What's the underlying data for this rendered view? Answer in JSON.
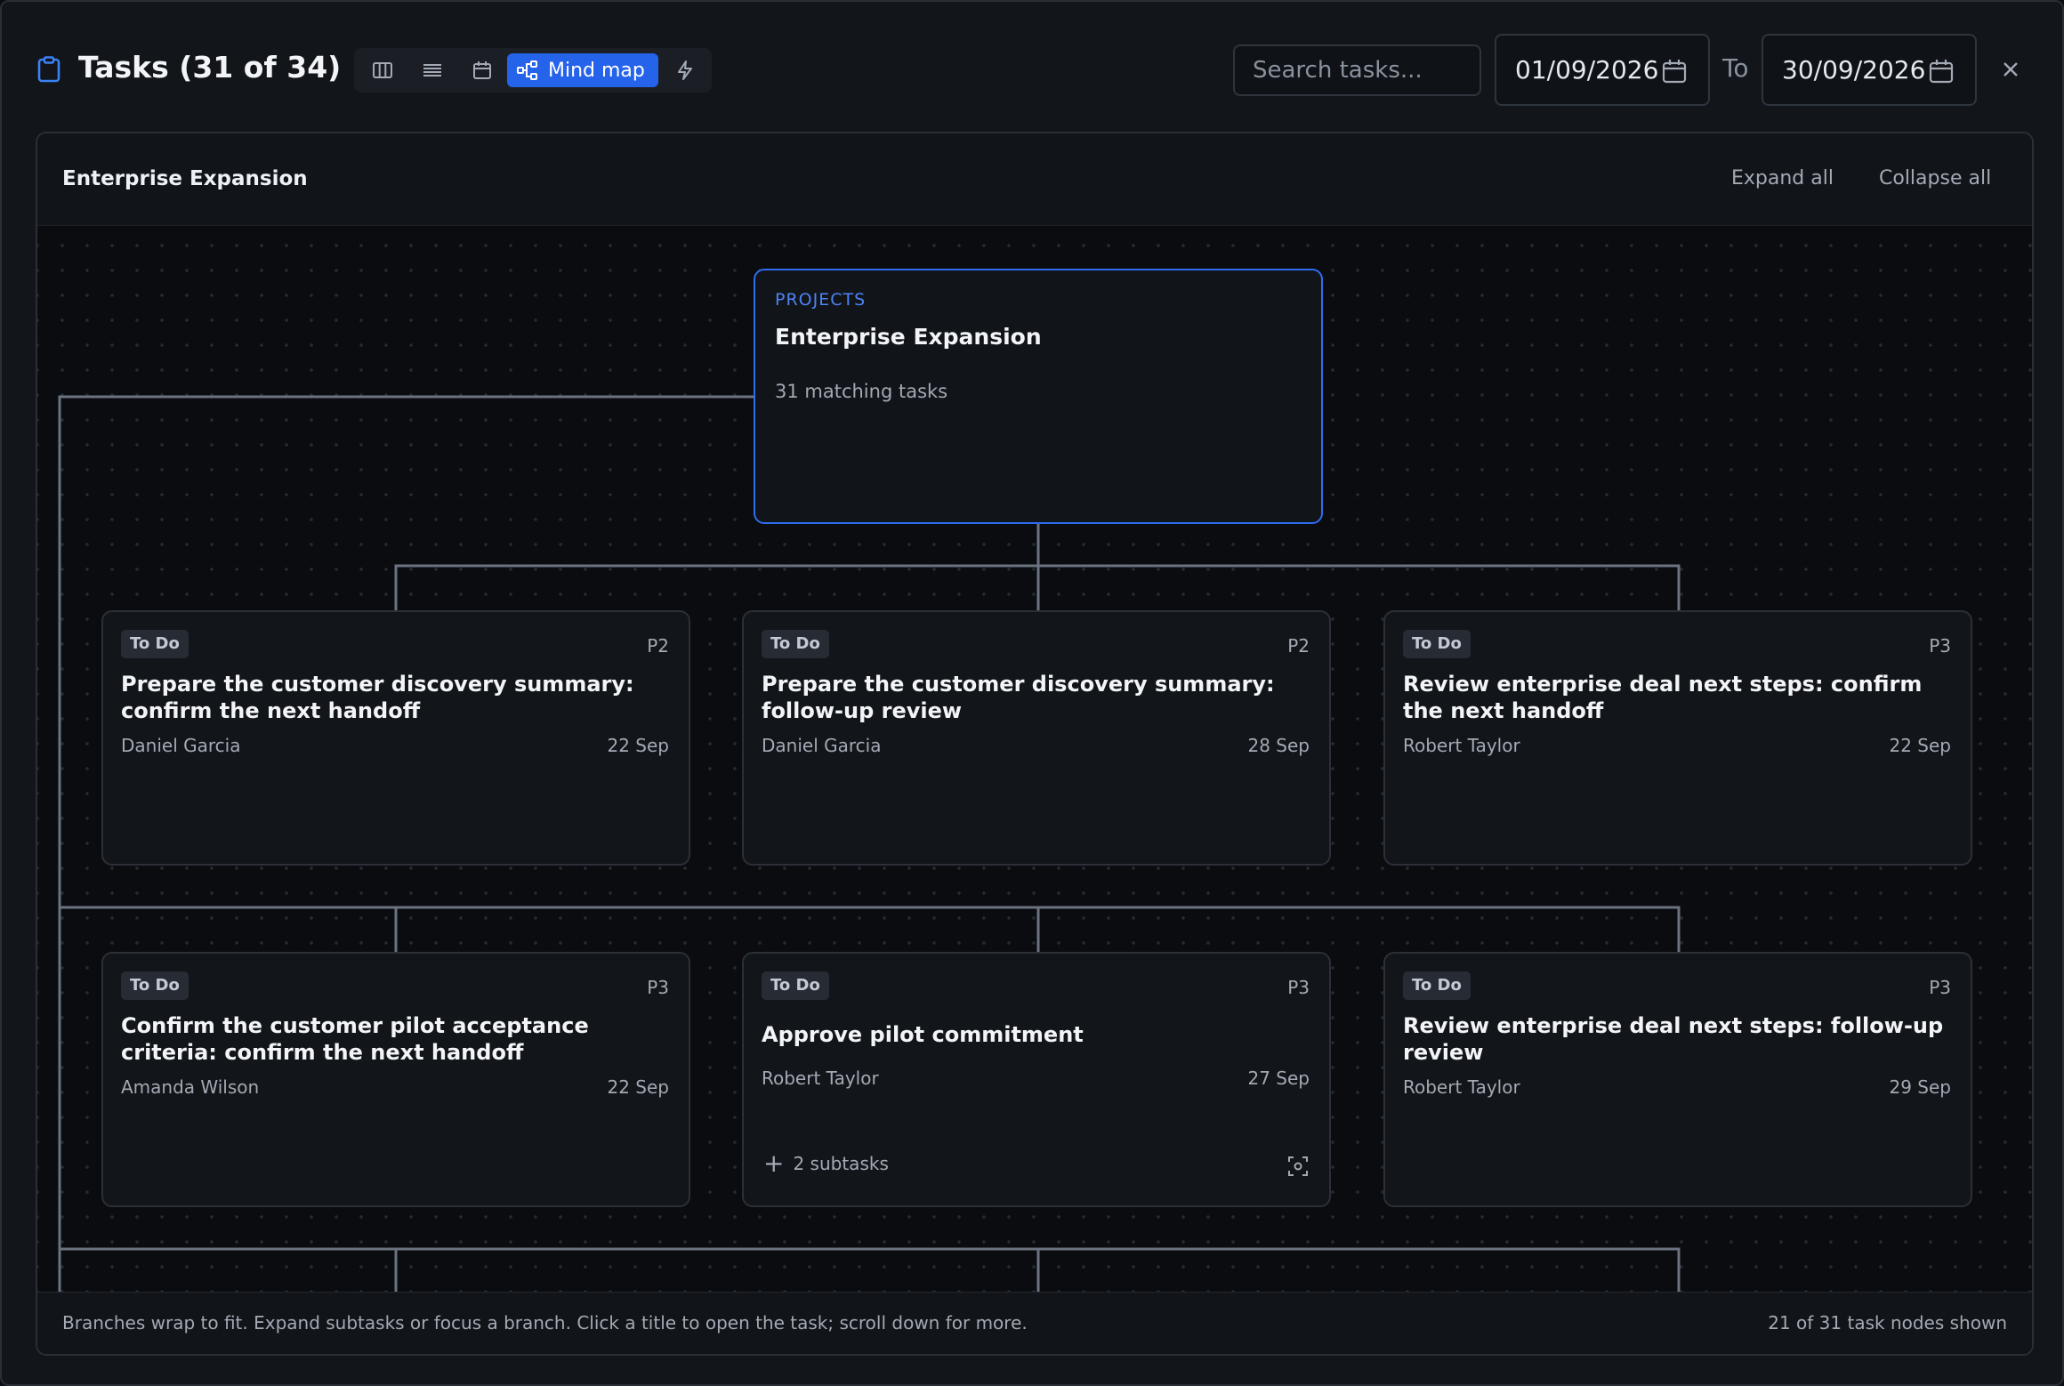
{
  "header": {
    "title": "Tasks (31 of 34)",
    "views": [
      {
        "name": "board-view",
        "icon": "columns-icon"
      },
      {
        "name": "list-view",
        "icon": "list-icon"
      },
      {
        "name": "calendar-view",
        "icon": "calendar-icon"
      },
      {
        "name": "mind-map-view",
        "icon": "mind-map-icon",
        "label": "Mind map",
        "active": true
      },
      {
        "name": "automation-view",
        "icon": "lightning-icon"
      }
    ],
    "mind_map_label": "Mind map",
    "search_placeholder": "Search tasks...",
    "date_from": "01/09/2026",
    "date_to_label": "To",
    "date_to": "30/09/2026"
  },
  "panel": {
    "title": "Enterprise Expansion",
    "expand_all": "Expand all",
    "collapse_all": "Collapse all"
  },
  "root": {
    "kicker": "PROJECTS",
    "title": "Enterprise Expansion",
    "subtitle": "31 matching tasks"
  },
  "tasks": [
    {
      "status": "To Do",
      "priority": "P2",
      "title": "Prepare the customer discovery summary: confirm the next handoff",
      "assignee": "Daniel Garcia",
      "due": "22 Sep"
    },
    {
      "status": "To Do",
      "priority": "P2",
      "title": "Prepare the customer discovery summary: follow-up review",
      "assignee": "Daniel Garcia",
      "due": "28 Sep"
    },
    {
      "status": "To Do",
      "priority": "P3",
      "title": "Review enterprise deal next steps: confirm the next handoff",
      "assignee": "Robert Taylor",
      "due": "22 Sep"
    },
    {
      "status": "To Do",
      "priority": "P3",
      "title": "Confirm the customer pilot acceptance criteria: confirm the next handoff",
      "assignee": "Amanda Wilson",
      "due": "22 Sep"
    },
    {
      "status": "To Do",
      "priority": "P3",
      "title": "Approve pilot commitment",
      "assignee": "Robert Taylor",
      "due": "27 Sep",
      "subtasks": "2 subtasks"
    },
    {
      "status": "To Do",
      "priority": "P3",
      "title": "Review enterprise deal next steps: follow-up review",
      "assignee": "Robert Taylor",
      "due": "29 Sep"
    }
  ],
  "footer": {
    "hint": "Branches wrap to fit. Expand subtasks or focus a branch. Click a title to open the task; scroll down for more.",
    "count": "21 of 31 task nodes shown"
  },
  "colors": {
    "accent": "#2563eb",
    "background": "#121519",
    "card_border": "#2b3038",
    "connector": "#6b7380"
  }
}
